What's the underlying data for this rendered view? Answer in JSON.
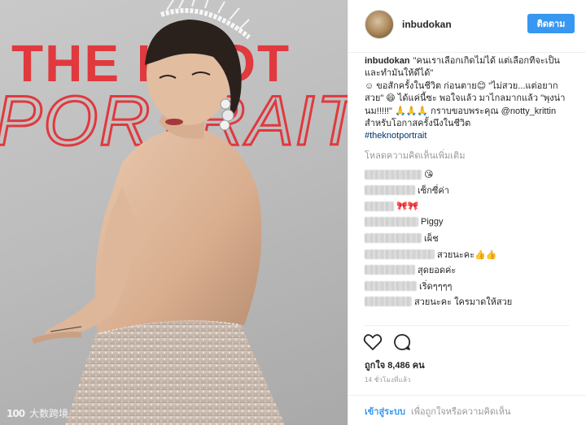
{
  "photo": {
    "headline_line1": "THE KNOT",
    "headline_line2": "PORTRAIT",
    "watermark_text": "大数跨境",
    "watermark_logo": "100"
  },
  "header": {
    "username": "inbudokan",
    "follow_label": "ติดตาม"
  },
  "caption": {
    "username": "inbudokan",
    "lines": [
      "\"คนเราเลือกเกิดไม่ได้ แต่เลือกที่จะเป็น และทำมันให้ดีได้\"",
      "☺ ขอสักครั้งในชีวิต ก่อนตาย😊 \"ไม่สวย...แต่อยากสวย\" 😄 ได้แค่นี้ซะ พอใจแล้ว มาไกลมากแล้ว \"พุงน่านม!!!!!\" 🙏🙏🙏 กราบขอบพระคุณ @notty_krittin สำหรับโอกาสครั้งนึงในชีวิต"
    ],
    "hashtag": "#theknotportrait"
  },
  "load_more": "โหลดความคิดเห็นเพิ่มเติม",
  "comments": [
    {
      "text": "😘",
      "blur_width": 70
    },
    {
      "text": "เซ็กซี่ค่า",
      "blur_width": 62
    },
    {
      "text": "🎀🎀",
      "blur_width": 36
    },
    {
      "text": "Piggy",
      "blur_width": 66
    },
    {
      "text": "เผ็ช",
      "blur_width": 70
    },
    {
      "text": "สวยนะคะ👍👍",
      "blur_width": 86
    },
    {
      "text": "สุดยอดค่ะ",
      "blur_width": 62
    },
    {
      "text": "เริ่ดๆๆๆๆ",
      "blur_width": 64
    },
    {
      "text": "สวยนะคะ ใครมาดให้สวย",
      "blur_width": 58
    }
  ],
  "likes": "ถูกใจ 8,486 คน",
  "time_ago": "14 ชั่วโมงที่แล้ว",
  "footer": {
    "login_label": "เข้าสู่ระบบ",
    "prompt_text": "เพื่อถูกใจหรือความคิดเห็น"
  },
  "colors": {
    "accent": "#3897f0",
    "headline_red": "#e0393e",
    "hashtag": "#003569",
    "muted": "#999999"
  },
  "icons": [
    "heart-icon",
    "comment-icon"
  ]
}
